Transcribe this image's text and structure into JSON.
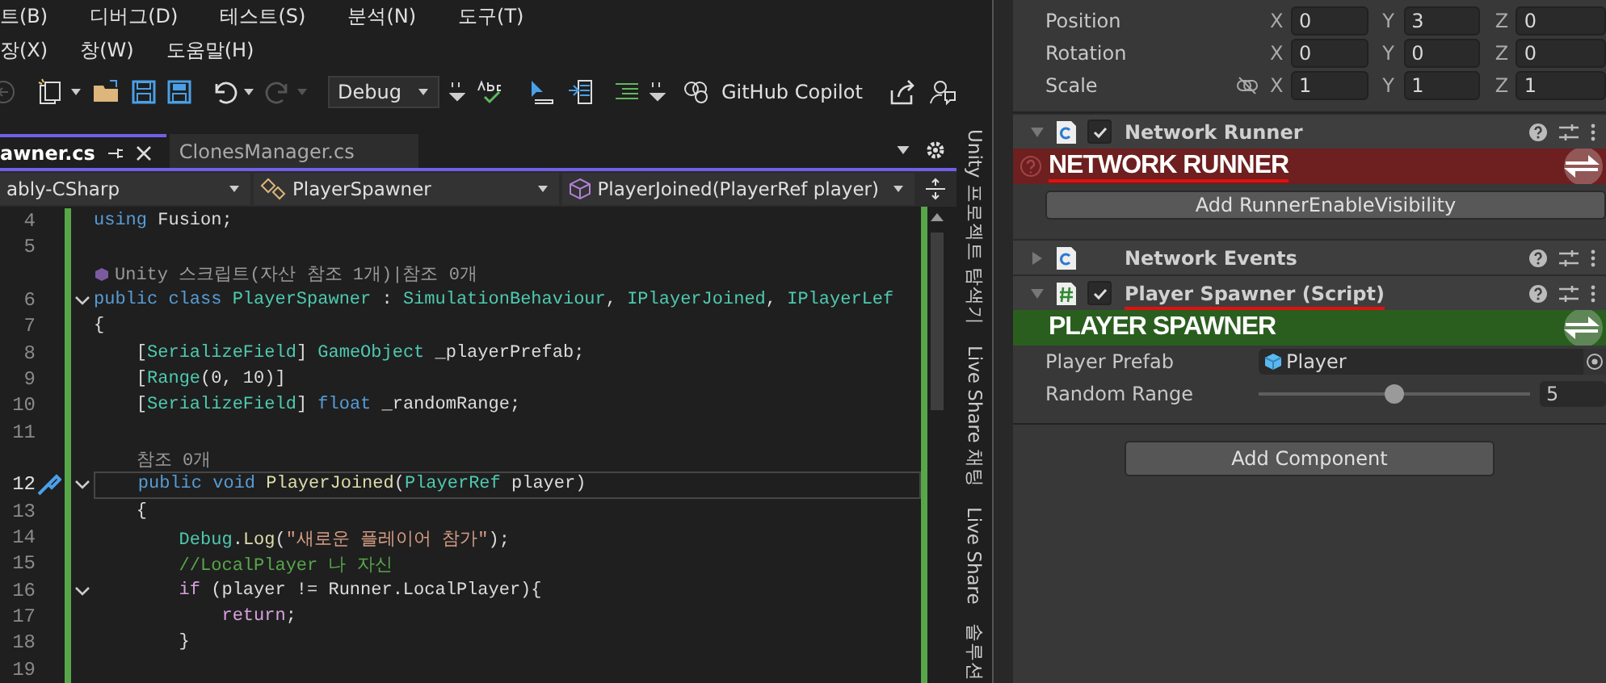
{
  "menu": [
    [
      "트(B)",
      "디버그(D)",
      "테스트(S)",
      "분석(N)",
      "도구(T)"
    ],
    [
      "장(X)",
      "창(W)",
      "도움말(H)"
    ]
  ],
  "toolbar": {
    "configuration": "Debug",
    "copilot": "GitHub Copilot"
  },
  "tabs": [
    {
      "label": "awner.cs",
      "selected": true
    },
    {
      "label": "ClonesManager.cs",
      "selected": false
    }
  ],
  "navbar": {
    "project": "ably-CSharp",
    "class": "PlayerSpawner",
    "member": "PlayerJoined(PlayerRef player)"
  },
  "code_lines": [
    {
      "kind": "code",
      "number": "4",
      "fold": false,
      "current": false,
      "tokens": [
        {
          "t": "using",
          "kind": "kw"
        },
        {
          "t": " Fusion;",
          "kind": "p"
        }
      ]
    },
    {
      "kind": "code",
      "number": "5",
      "fold": false,
      "current": false
    },
    {
      "kind": "unity-lens",
      "text": "Unity 스크립트(자산 참조 1개)|참조 0개",
      "fold": false,
      "current": false
    },
    {
      "kind": "code",
      "number": "6",
      "fold": true,
      "current": false,
      "tokens": [
        {
          "t": "public class",
          "kind": "kw"
        },
        {
          "t": " PlayerSpawner",
          "kind": "ty"
        },
        {
          "t": " : ",
          "kind": "p"
        },
        {
          "t": "SimulationBehaviour",
          "kind": "ty"
        },
        {
          "t": ", ",
          "kind": "p"
        },
        {
          "t": "IPlayerJoined",
          "kind": "ty"
        },
        {
          "t": ", ",
          "kind": "p"
        },
        {
          "t": "IPlayerLef",
          "kind": "ty"
        }
      ]
    },
    {
      "kind": "code",
      "number": "7",
      "fold": false,
      "current": false,
      "tokens": [
        {
          "t": "{",
          "kind": "p"
        }
      ]
    },
    {
      "kind": "code",
      "number": "8",
      "fold": false,
      "current": false,
      "tokens": [
        {
          "t": "    [",
          "kind": "p"
        },
        {
          "t": "SerializeField",
          "kind": "ty"
        },
        {
          "t": "] ",
          "kind": "p"
        },
        {
          "t": "GameObject",
          "kind": "ty"
        },
        {
          "t": " _playerPrefab;",
          "kind": "p"
        }
      ]
    },
    {
      "kind": "code",
      "number": "9",
      "fold": false,
      "current": false,
      "tokens": [
        {
          "t": "    [",
          "kind": "p"
        },
        {
          "t": "Range",
          "kind": "ty"
        },
        {
          "t": "(0, 10)]",
          "kind": "p"
        }
      ]
    },
    {
      "kind": "code",
      "number": "10",
      "fold": false,
      "current": false,
      "tokens": [
        {
          "t": "    [",
          "kind": "p"
        },
        {
          "t": "SerializeField",
          "kind": "ty"
        },
        {
          "t": "] ",
          "kind": "p"
        },
        {
          "t": "float",
          "kind": "kw"
        },
        {
          "t": " _randomRange;",
          "kind": "p"
        }
      ]
    },
    {
      "kind": "code",
      "number": "11",
      "fold": false,
      "current": false
    },
    {
      "kind": "lens",
      "text": "    참조 0개",
      "fold": false,
      "current": false
    },
    {
      "kind": "code",
      "number": "12",
      "fold": true,
      "current": true,
      "tokens": [
        {
          "t": "    public void",
          "kind": "kw"
        },
        {
          "t": " PlayerJoined",
          "kind": "fn"
        },
        {
          "t": "(",
          "kind": "p"
        },
        {
          "t": "PlayerRef",
          "kind": "ty"
        },
        {
          "t": " player)",
          "kind": "p"
        }
      ]
    },
    {
      "kind": "code",
      "number": "13",
      "fold": false,
      "current": false,
      "tokens": [
        {
          "t": "    {",
          "kind": "p"
        }
      ]
    },
    {
      "kind": "code",
      "number": "14",
      "fold": false,
      "current": false,
      "tokens": [
        {
          "t": "        Debug",
          "kind": "ty"
        },
        {
          "t": ".",
          "kind": "p"
        },
        {
          "t": "Log",
          "kind": "fn"
        },
        {
          "t": "(",
          "kind": "p"
        },
        {
          "t": "\"새로운 플레이어 참가\"",
          "kind": "str"
        },
        {
          "t": ");",
          "kind": "p"
        }
      ]
    },
    {
      "kind": "code",
      "number": "15",
      "fold": false,
      "current": false,
      "tokens": [
        {
          "t": "        //LocalPlayer 나 자신",
          "kind": "cm"
        }
      ]
    },
    {
      "kind": "code",
      "number": "16",
      "fold": true,
      "current": false,
      "tokens": [
        {
          "t": "        if",
          "kind": "ctl"
        },
        {
          "t": " (player != Runner.LocalPlayer){",
          "kind": "p"
        }
      ]
    },
    {
      "kind": "code",
      "number": "17",
      "fold": false,
      "current": false,
      "tokens": [
        {
          "t": "            return",
          "kind": "ctl"
        },
        {
          "t": ";",
          "kind": "p"
        }
      ]
    },
    {
      "kind": "code",
      "number": "18",
      "fold": false,
      "current": false,
      "tokens": [
        {
          "t": "        }",
          "kind": "p"
        }
      ]
    },
    {
      "kind": "code",
      "number": "19",
      "fold": false,
      "current": false
    }
  ],
  "side_tabs": [
    "Unity 프로젝트 탐색기",
    "Live Share 채팅",
    "Live Share",
    "솔루션"
  ],
  "transform": [
    {
      "label": "Position",
      "kind": "vector",
      "axes": [
        {
          "axis": "X",
          "value": "0"
        },
        {
          "axis": "Y",
          "value": "3"
        },
        {
          "axis": "Z",
          "value": "0"
        }
      ]
    },
    {
      "label": "Rotation",
      "kind": "vector",
      "axes": [
        {
          "axis": "X",
          "value": "0"
        },
        {
          "axis": "Y",
          "value": "0"
        },
        {
          "axis": "Z",
          "value": "0"
        }
      ]
    },
    {
      "label": "Scale",
      "kind": "scale",
      "axes": [
        {
          "axis": "X",
          "value": "1"
        },
        {
          "axis": "Y",
          "value": "1"
        },
        {
          "axis": "Z",
          "value": "1"
        }
      ]
    }
  ],
  "components": [
    {
      "title": "Network Runner",
      "kind": "fusion",
      "expanded": true,
      "enabled": true,
      "underlined": false,
      "banner": {
        "text": "NETWORK RUNNER",
        "color": "#6e1f1f",
        "help": true,
        "underlined": true
      },
      "buttons": [
        "Add RunnerEnableVisibility"
      ]
    },
    {
      "title": "Network Events",
      "kind": "fusion",
      "expanded": false,
      "underlined": false
    },
    {
      "title": "Player Spawner (Script)",
      "kind": "script",
      "expanded": true,
      "enabled": true,
      "underlined": true,
      "banner": {
        "text": "PLAYER SPAWNER",
        "color": "#2a5e1f",
        "help": false,
        "underlined": false
      },
      "properties": [
        {
          "kind": "object",
          "label": "Player Prefab",
          "value": "Player"
        },
        {
          "kind": "slider",
          "label": "Random Range",
          "level": 0.5,
          "value": "5"
        }
      ]
    }
  ],
  "add_component": "Add Component"
}
